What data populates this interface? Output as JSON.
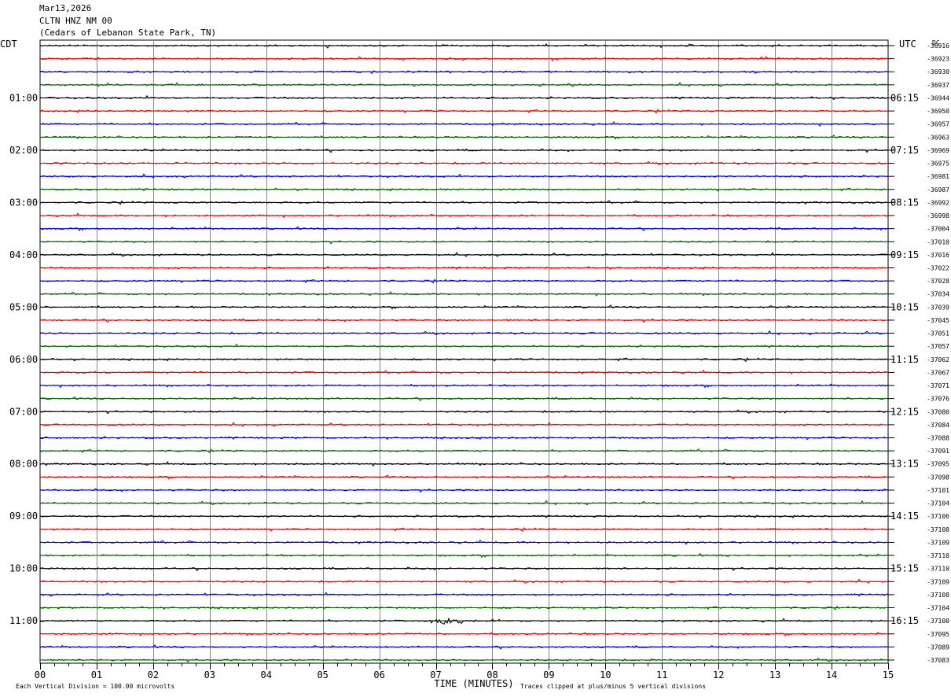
{
  "header": {
    "date": "Mar13,2026",
    "station": "CLTN HNZ NM 00",
    "location": "(Cedars of Lebanon State Park, TN)"
  },
  "chart_data": {
    "type": "line",
    "title": "CLTN HNZ NM 00",
    "left_axis_label": "CDT",
    "right_axis_label": "UTC",
    "dc_label": "DC",
    "xlabel": "TIME (MINUTES)",
    "x_ticks": [
      "00",
      "01",
      "02",
      "03",
      "04",
      "05",
      "06",
      "07",
      "08",
      "09",
      "10",
      "11",
      "12",
      "13",
      "14",
      "15"
    ],
    "xlim": [
      0,
      15
    ],
    "trace_colors": [
      "#000000",
      "#ee0000",
      "#0000ee",
      "#006600"
    ],
    "traces_per_hour": 4,
    "minutes_per_trace": 15,
    "left_hour_labels": [
      "01:00",
      "02:00",
      "03:00",
      "04:00",
      "05:00",
      "06:00",
      "07:00",
      "08:00",
      "09:00",
      "10:00",
      "11:00"
    ],
    "right_hour_labels": [
      "06:15",
      "07:15",
      "08:15",
      "09:15",
      "10:15",
      "11:15",
      "12:15",
      "13:15",
      "14:15",
      "15:15",
      "16:15"
    ],
    "dc_offsets": [
      "-36916",
      "-36923",
      "-36930",
      "-36937",
      "-36944",
      "-36950",
      "-36957",
      "-36963",
      "-36969",
      "-36975",
      "-36981",
      "-36987",
      "-36992",
      "-36998",
      "-37004",
      "-37010",
      "-37016",
      "-37022",
      "-37028",
      "-37034",
      "-37039",
      "-37045",
      "-37051",
      "-37057",
      "-37062",
      "-37067",
      "-37071",
      "-37076",
      "-37080",
      "-37084",
      "-37088",
      "-37091",
      "-37095",
      "-37098",
      "-37101",
      "-37104",
      "-37106",
      "-37108",
      "-37109",
      "-37110",
      "-37110",
      "-37109",
      "-37108",
      "-37104",
      "-37100",
      "-37095",
      "-37089",
      "-37083"
    ],
    "event": {
      "trace_index": 44,
      "start_minute": 6.9,
      "end_minute": 7.5
    },
    "footer_left": "Each Vertical Division =  100.00 microvolts",
    "footer_right": "Traces clipped at plus/minus 5 vertical divisions"
  }
}
